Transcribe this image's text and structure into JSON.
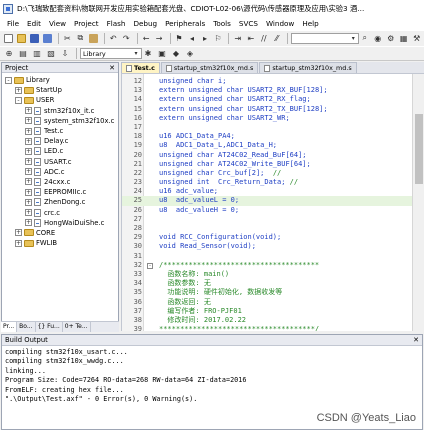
{
  "window": {
    "title": "D:\\飞瑞致配套资料\\物联网开发应用实验箱配套光盘、CDIOT-L02-06\\源代码\\传感器原理及应用\\实验3 酒..."
  },
  "menu": [
    "File",
    "Edit",
    "View",
    "Project",
    "Flash",
    "Debug",
    "Peripherals",
    "Tools",
    "SVCS",
    "Window",
    "Help"
  ],
  "toolbar": {
    "target": "Library"
  },
  "project_panel": {
    "title": "Project",
    "tree": [
      {
        "label": "Library",
        "level": 0,
        "type": "folder",
        "expand": "-"
      },
      {
        "label": "StartUp",
        "level": 1,
        "type": "folder",
        "expand": "+"
      },
      {
        "label": "USER",
        "level": 1,
        "type": "folder",
        "expand": "-"
      },
      {
        "label": "stm32f10x_it.c",
        "level": 2,
        "type": "file",
        "expand": "+"
      },
      {
        "label": "system_stm32f10x.c",
        "level": 2,
        "type": "file",
        "expand": "+"
      },
      {
        "label": "Test.c",
        "level": 2,
        "type": "file",
        "expand": "+"
      },
      {
        "label": "Delay.c",
        "level": 2,
        "type": "file",
        "expand": "+"
      },
      {
        "label": "LED.c",
        "level": 2,
        "type": "file",
        "expand": "+"
      },
      {
        "label": "USART.c",
        "level": 2,
        "type": "file",
        "expand": "+"
      },
      {
        "label": "ADC.c",
        "level": 2,
        "type": "file",
        "expand": "+"
      },
      {
        "label": "24cxx.c",
        "level": 2,
        "type": "file",
        "expand": "+"
      },
      {
        "label": "EEPROMIIc.c",
        "level": 2,
        "type": "file",
        "expand": "+"
      },
      {
        "label": "ZhenDong.c",
        "level": 2,
        "type": "file",
        "expand": "+"
      },
      {
        "label": "crc.c",
        "level": 2,
        "type": "file",
        "expand": "+"
      },
      {
        "label": "HongWaiDuiShe.c",
        "level": 2,
        "type": "file",
        "expand": "+"
      },
      {
        "label": "CORE",
        "level": 1,
        "type": "folder",
        "expand": "+"
      },
      {
        "label": "FWLIB",
        "level": 1,
        "type": "folder",
        "expand": "+"
      }
    ],
    "tabs": [
      "Pr...",
      "Bo...",
      "{} Fu...",
      "0+ Te..."
    ]
  },
  "editor": {
    "tabs": [
      "Test.c",
      "startup_stm32f10x_md.s",
      "startup_stm32f10x_md.s"
    ],
    "lines": [
      {
        "n": "12",
        "fold": "",
        "hl": false,
        "segs": [
          [
            "kw",
            "unsigned char "
          ],
          [
            "tx",
            "i;"
          ]
        ]
      },
      {
        "n": "13",
        "fold": "",
        "hl": false,
        "segs": [
          [
            "kw",
            "extern unsigned char "
          ],
          [
            "tx",
            "USART2_RX_BUF[128];"
          ]
        ]
      },
      {
        "n": "14",
        "fold": "",
        "hl": false,
        "segs": [
          [
            "kw",
            "extern unsigned char "
          ],
          [
            "tx",
            "USART2_RX_flag;"
          ]
        ]
      },
      {
        "n": "15",
        "fold": "",
        "hl": false,
        "segs": [
          [
            "kw",
            "extern unsigned char "
          ],
          [
            "tx",
            "USART2_TX_BUF[128];"
          ]
        ]
      },
      {
        "n": "16",
        "fold": "",
        "hl": false,
        "segs": [
          [
            "kw",
            "extern unsigned char "
          ],
          [
            "tx",
            "USART2_WR;"
          ]
        ]
      },
      {
        "n": "17",
        "fold": "",
        "hl": false,
        "segs": []
      },
      {
        "n": "18",
        "fold": "",
        "hl": false,
        "segs": [
          [
            "tx",
            "u16 ADC1_Data_PA4;"
          ]
        ]
      },
      {
        "n": "19",
        "fold": "",
        "hl": false,
        "segs": [
          [
            "tx",
            "u8  ADC1_Data_L,ADC1_Data_H;"
          ]
        ]
      },
      {
        "n": "20",
        "fold": "",
        "hl": false,
        "segs": [
          [
            "kw",
            "unsigned char "
          ],
          [
            "tx",
            "AT24C02_Read_BuF[64];"
          ]
        ]
      },
      {
        "n": "21",
        "fold": "",
        "hl": false,
        "segs": [
          [
            "kw",
            "unsigned char "
          ],
          [
            "tx",
            "AT24C02_Write_BUF[64];"
          ]
        ]
      },
      {
        "n": "22",
        "fold": "",
        "hl": false,
        "segs": [
          [
            "kw",
            "unsigned char "
          ],
          [
            "tx",
            "Crc_buf[2];  "
          ],
          [
            "cm",
            "//"
          ]
        ]
      },
      {
        "n": "23",
        "fold": "",
        "hl": false,
        "segs": [
          [
            "kw",
            "unsigned int  "
          ],
          [
            "tx",
            "Crc_Return_Data; "
          ],
          [
            "cm",
            "//"
          ]
        ]
      },
      {
        "n": "24",
        "fold": "",
        "hl": false,
        "segs": [
          [
            "tx",
            "u16 adc_value;"
          ]
        ]
      },
      {
        "n": "25",
        "fold": "",
        "hl": true,
        "segs": [
          [
            "tx",
            "u8  adc_valueL = 0;"
          ]
        ]
      },
      {
        "n": "26",
        "fold": "",
        "hl": false,
        "segs": [
          [
            "tx",
            "u8  adc_valueH = 0;"
          ]
        ]
      },
      {
        "n": "27",
        "fold": "",
        "hl": false,
        "segs": []
      },
      {
        "n": "28",
        "fold": "",
        "hl": false,
        "segs": []
      },
      {
        "n": "29",
        "fold": "",
        "hl": false,
        "segs": [
          [
            "kw",
            "void "
          ],
          [
            "tx",
            "RCC_Configuration(void);"
          ]
        ]
      },
      {
        "n": "30",
        "fold": "",
        "hl": false,
        "segs": [
          [
            "kw",
            "void "
          ],
          [
            "tx",
            "Read_Sensor(void);"
          ]
        ]
      },
      {
        "n": "31",
        "fold": "",
        "hl": false,
        "segs": []
      },
      {
        "n": "32",
        "fold": "-",
        "hl": false,
        "segs": [
          [
            "cm",
            "/*************************************"
          ]
        ]
      },
      {
        "n": "33",
        "fold": "",
        "hl": false,
        "segs": [
          [
            "cm",
            "  函数名称: main()"
          ]
        ]
      },
      {
        "n": "34",
        "fold": "",
        "hl": false,
        "segs": [
          [
            "cm",
            "  函数参数: 无"
          ]
        ]
      },
      {
        "n": "35",
        "fold": "",
        "hl": false,
        "segs": [
          [
            "cm",
            "  功能说明: 硬件初始化, 数据收发等"
          ]
        ]
      },
      {
        "n": "36",
        "fold": "",
        "hl": false,
        "segs": [
          [
            "cm",
            "  函数返回: 无"
          ]
        ]
      },
      {
        "n": "37",
        "fold": "",
        "hl": false,
        "segs": [
          [
            "cm",
            "  编写作者: FRO-PJF01"
          ]
        ]
      },
      {
        "n": "38",
        "fold": "",
        "hl": false,
        "segs": [
          [
            "cm",
            "  修改时间: 2017.02.22"
          ]
        ]
      },
      {
        "n": "39",
        "fold": "",
        "hl": false,
        "segs": [
          [
            "cm",
            "*************************************/"
          ]
        ]
      }
    ]
  },
  "build_output": {
    "title": "Build Output",
    "lines": [
      "compiling stm32f10x_usart.c...",
      "compiling stm32f10x_wwdg.c...",
      "linking...",
      "Program Size: Code=7264 RO-data=268 RW-data=64 ZI-data=2016",
      "FromELF: creating hex file...",
      "\".\\Output\\Test.axf\" - 0 Error(s), 0 Warning(s)."
    ]
  },
  "watermark": "CSDN @Yeats_Liao",
  "colors": {
    "keyword": "#1f3fc4",
    "comment": "#2a8a2a",
    "active_tab": "#fff4c4",
    "highlight_line": "#e6f4de"
  }
}
